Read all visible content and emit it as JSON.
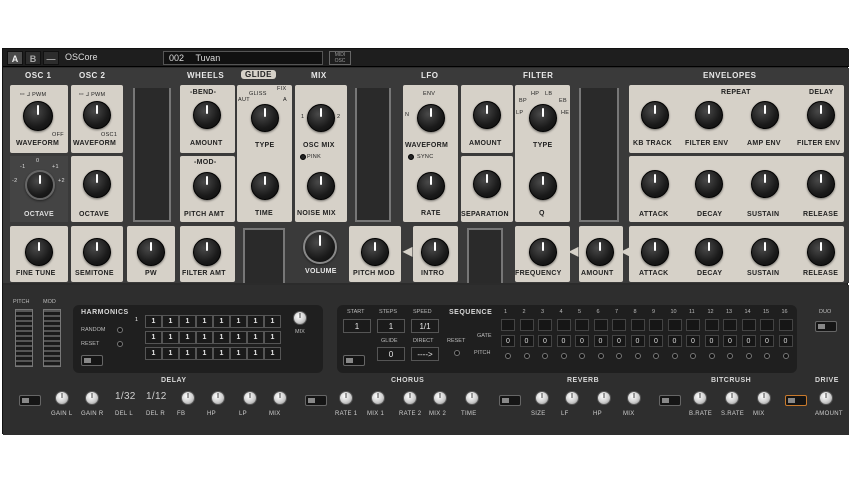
{
  "topbar": {
    "btn_a": "A",
    "btn_b": "B",
    "btn_dash": "—",
    "app_name": "OSCore",
    "preset_number": "002",
    "preset_name": "Tuvan",
    "midi_label": "MIDI",
    "osc_label": "OSC"
  },
  "headers": {
    "osc1": "OSC 1",
    "osc2": "OSC 2",
    "wheels": "WHEELS",
    "glide": "GLIDE",
    "mix": "MIX",
    "lfo": "LFO",
    "filter": "FILTER",
    "envelopes": "ENVELOPES"
  },
  "osc1": {
    "waveform": "WAVEFORM",
    "octave": "OCTAVE",
    "fine_tune": "FINE TUNE",
    "wave_marks": "ꟷ ᒧ PWM",
    "off": "OFF",
    "oct_marks": [
      "0",
      "-1",
      "+1",
      "-2",
      "+2"
    ]
  },
  "osc2": {
    "waveform": "WAVEFORM",
    "octave": "OCTAVE",
    "semitone": "SEMITONE",
    "pw": "PW",
    "osc1": "OSC1",
    "wave_marks": "ꟷ ᒧ PWM"
  },
  "wheels": {
    "bend": "-BEND-",
    "amount": "AMOUNT",
    "mod": "-MOD-",
    "pitch_amt": "PITCH AMT",
    "filter_amt": "FILTER AMT"
  },
  "glide": {
    "type_top": "GLISS",
    "fix": "FIX",
    "aut": "AUT",
    "n": "N",
    "a": "A",
    "type": "TYPE",
    "time": "TIME"
  },
  "mix": {
    "osc_mix": "OSC MIX",
    "pink": "PINK",
    "noise_mix": "NOISE MIX",
    "volume": "VOLUME",
    "one": "1",
    "two": "2"
  },
  "lfo": {
    "waveform": "WAVEFORM",
    "sync": "SYNC",
    "rate": "RATE",
    "amount": "AMOUNT",
    "pitch_mod": "PITCH MOD",
    "intro": "INTRO",
    "env": "ENV",
    "n": "N"
  },
  "filter": {
    "hp": "HP",
    "lb": "LB",
    "bp": "BP",
    "eb": "EB",
    "lp": "LP",
    "he": "HE",
    "type": "TYPE",
    "separation": "SEPARATION",
    "q": "Q",
    "frequency": "FREQUENCY",
    "amount": "AMOUNT"
  },
  "envelopes": {
    "repeat": "REPEAT",
    "delay": "DELAY",
    "row1": [
      "KB TRACK",
      "FILTER ENV",
      "AMP ENV",
      "FILTER ENV"
    ],
    "row2": [
      "ATTACK",
      "DECAY",
      "SUSTAIN",
      "RELEASE"
    ],
    "row3": [
      "ATTACK",
      "DECAY",
      "SUSTAIN",
      "RELEASE"
    ]
  },
  "bottom": {
    "pitch": "PITCH",
    "mod": "MOD",
    "harmonics": "HARMONICS",
    "random": "RANDOM",
    "reset": "RESET",
    "mix": "MIX",
    "harm_grid": [
      [
        "1",
        "1",
        "1",
        "1",
        "1",
        "1",
        "1",
        "1"
      ],
      [
        "1",
        "1",
        "1",
        "1",
        "1",
        "1",
        "1",
        "1"
      ],
      [
        "1",
        "1",
        "1",
        "1",
        "1",
        "1",
        "1",
        "1"
      ]
    ],
    "row_label": "1",
    "start": "START",
    "steps": "STEPS",
    "speed": "SPEED",
    "sequence": "SEQUENCE",
    "start_val": "1",
    "steps_val": "1",
    "speed_val": "1/1",
    "glide": "GLIDE",
    "direct": "DIRECT",
    "glide_val": "0",
    "direct_val": "---->",
    "gate": "GATE",
    "pitch_lbl": "PITCH",
    "seq_numbers": [
      "1",
      "2",
      "3",
      "4",
      "5",
      "6",
      "7",
      "8",
      "9",
      "10",
      "11",
      "12",
      "13",
      "14",
      "15",
      "16"
    ],
    "seq_pitch": [
      "0",
      "0",
      "0",
      "0",
      "0",
      "0",
      "0",
      "0",
      "0",
      "0",
      "0",
      "0",
      "0",
      "0",
      "0",
      "0"
    ],
    "duo": "DUO",
    "delay": "DELAY",
    "delay_labels": [
      "GAIN L",
      "GAIN R",
      "DEL L",
      "DEL R",
      "FB",
      "HP",
      "LP",
      "MIX"
    ],
    "del_l_val": "1/32",
    "del_r_val": "1/12",
    "chorus": "CHORUS",
    "chorus_labels": [
      "RATE 1",
      "MIX 1",
      "RATE 2",
      "MIX 2",
      "TIME"
    ],
    "reverb": "REVERB",
    "reverb_labels": [
      "SIZE",
      "LF",
      "HP",
      "MIX"
    ],
    "bitcrush": "BITCRUSH",
    "bitcrush_labels": [
      "B.RATE",
      "S.RATE",
      "MIX"
    ],
    "drive": "DRIVE",
    "drive_label": "AMOUNT"
  }
}
